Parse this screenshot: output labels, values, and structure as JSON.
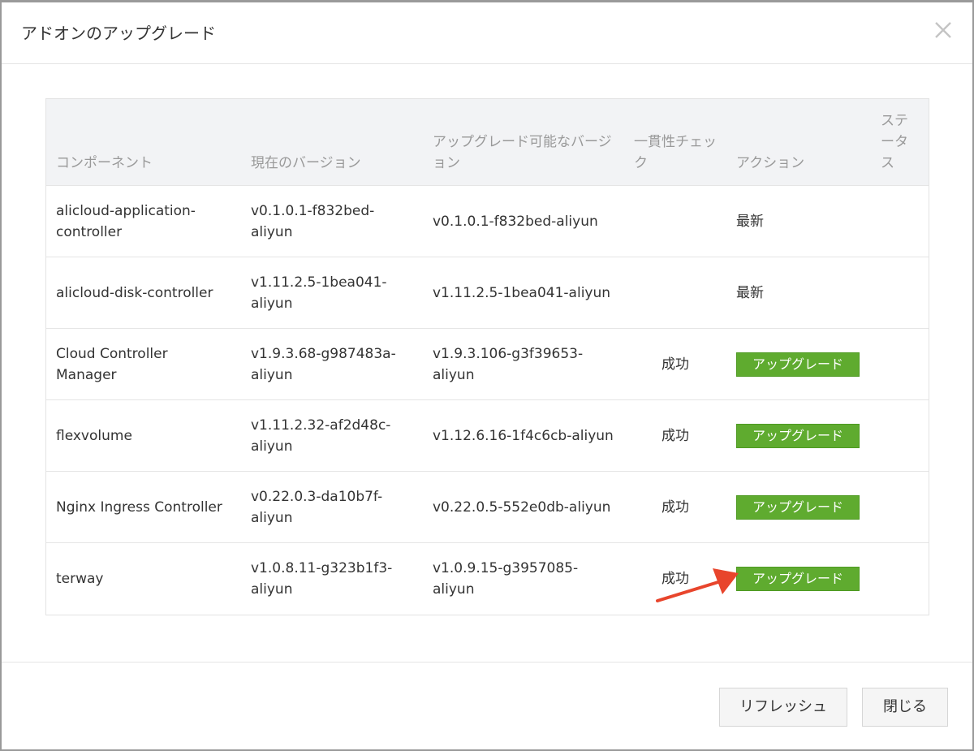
{
  "dialog": {
    "title": "アドオンのアップグレード",
    "close_icon": "close-icon"
  },
  "table": {
    "columns": [
      "コンポーネント",
      "現在のバージョン",
      "アップグレード可能なバージョン",
      "一貫性チェック",
      "アクション",
      "ステータス"
    ],
    "rows": [
      {
        "component": "alicloud-application-controller",
        "current": "v0.1.0.1-f832bed-aliyun",
        "available": "v0.1.0.1-f832bed-aliyun",
        "check": "",
        "action_text": "最新",
        "action_button": ""
      },
      {
        "component": "alicloud-disk-controller",
        "current": "v1.11.2.5-1bea041-aliyun",
        "available": "v1.11.2.5-1bea041-aliyun",
        "check": "",
        "action_text": "最新",
        "action_button": ""
      },
      {
        "component": "Cloud Controller Manager",
        "current": "v1.9.3.68-g987483a-aliyun",
        "available": "v1.9.3.106-g3f39653-aliyun",
        "check": "成功",
        "action_text": "",
        "action_button": "アップグレード"
      },
      {
        "component": "flexvolume",
        "current": "v1.11.2.32-af2d48c-aliyun",
        "available": "v1.12.6.16-1f4c6cb-aliyun",
        "check": "成功",
        "action_text": "",
        "action_button": "アップグレード"
      },
      {
        "component": "Nginx Ingress Controller",
        "current": "v0.22.0.3-da10b7f-aliyun",
        "available": "v0.22.0.5-552e0db-aliyun",
        "check": "成功",
        "action_text": "",
        "action_button": "アップグレード"
      },
      {
        "component": "terway",
        "current": "v1.0.8.11-g323b1f3-aliyun",
        "available": "v1.0.9.15-g3957085-aliyun",
        "check": "成功",
        "action_text": "",
        "action_button": "アップグレード"
      }
    ]
  },
  "footer": {
    "refresh_label": "リフレッシュ",
    "close_label": "閉じる"
  },
  "colors": {
    "upgrade_button": "#5fab2f",
    "annotation_arrow": "#e8452c"
  }
}
